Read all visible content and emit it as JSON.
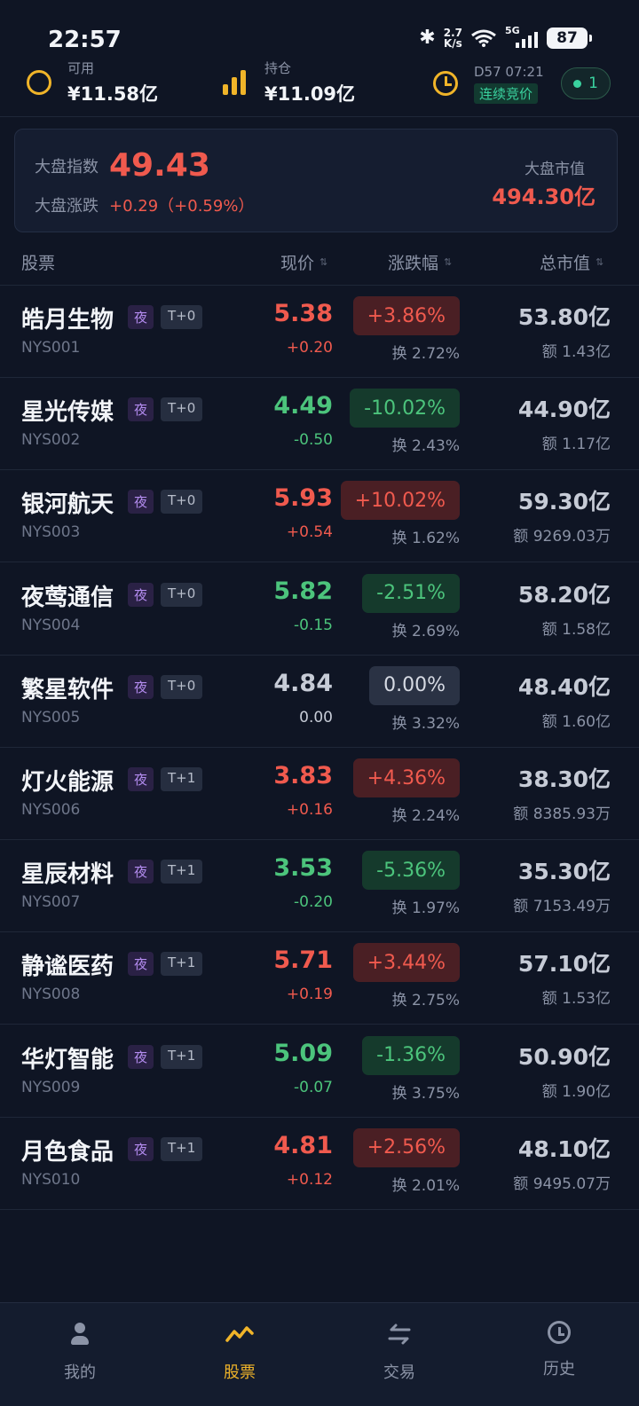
{
  "status_bar": {
    "time": "22:57",
    "net_speed_value": "2.7",
    "net_speed_unit": "K/s",
    "network": "5G",
    "battery": "87"
  },
  "header": {
    "available_label": "可用",
    "available_value": "¥11.58亿",
    "holding_label": "持仓",
    "holding_value": "¥11.09亿",
    "day_time": "D57 07:21",
    "phase": "连续竞价",
    "online_count": "1"
  },
  "index_card": {
    "index_label": "大盘指数",
    "index_value": "49.43",
    "change_label": "大盘涨跌",
    "change_value": "+0.29（+0.59%）",
    "market_cap_label": "大盘市值",
    "market_cap_value": "494.30亿"
  },
  "columns": {
    "stock": "股票",
    "price": "现价",
    "change_pct": "涨跌幅",
    "market_cap": "总市值"
  },
  "stocks": [
    {
      "name": "皓月生物",
      "tag_night": "夜",
      "tag_t": "T+0",
      "code": "NYS001",
      "price": "5.38",
      "delta": "+0.20",
      "pct": "+3.86%",
      "turnover": "换 2.72%",
      "market_cap": "53.80亿",
      "amount": "额 1.43亿",
      "trend": "up"
    },
    {
      "name": "星光传媒",
      "tag_night": "夜",
      "tag_t": "T+0",
      "code": "NYS002",
      "price": "4.49",
      "delta": "-0.50",
      "pct": "-10.02%",
      "turnover": "换 2.43%",
      "market_cap": "44.90亿",
      "amount": "额 1.17亿",
      "trend": "down"
    },
    {
      "name": "银河航天",
      "tag_night": "夜",
      "tag_t": "T+0",
      "code": "NYS003",
      "price": "5.93",
      "delta": "+0.54",
      "pct": "+10.02%",
      "turnover": "换 1.62%",
      "market_cap": "59.30亿",
      "amount": "额 9269.03万",
      "trend": "up"
    },
    {
      "name": "夜莺通信",
      "tag_night": "夜",
      "tag_t": "T+0",
      "code": "NYS004",
      "price": "5.82",
      "delta": "-0.15",
      "pct": "-2.51%",
      "turnover": "换 2.69%",
      "market_cap": "58.20亿",
      "amount": "额 1.58亿",
      "trend": "down"
    },
    {
      "name": "繁星软件",
      "tag_night": "夜",
      "tag_t": "T+0",
      "code": "NYS005",
      "price": "4.84",
      "delta": "0.00",
      "pct": "0.00%",
      "turnover": "换 3.32%",
      "market_cap": "48.40亿",
      "amount": "额 1.60亿",
      "trend": "flat"
    },
    {
      "name": "灯火能源",
      "tag_night": "夜",
      "tag_t": "T+1",
      "code": "NYS006",
      "price": "3.83",
      "delta": "+0.16",
      "pct": "+4.36%",
      "turnover": "换 2.24%",
      "market_cap": "38.30亿",
      "amount": "额 8385.93万",
      "trend": "up"
    },
    {
      "name": "星辰材料",
      "tag_night": "夜",
      "tag_t": "T+1",
      "code": "NYS007",
      "price": "3.53",
      "delta": "-0.20",
      "pct": "-5.36%",
      "turnover": "换 1.97%",
      "market_cap": "35.30亿",
      "amount": "额 7153.49万",
      "trend": "down"
    },
    {
      "name": "静谧医药",
      "tag_night": "夜",
      "tag_t": "T+1",
      "code": "NYS008",
      "price": "5.71",
      "delta": "+0.19",
      "pct": "+3.44%",
      "turnover": "换 2.75%",
      "market_cap": "57.10亿",
      "amount": "额 1.53亿",
      "trend": "up"
    },
    {
      "name": "华灯智能",
      "tag_night": "夜",
      "tag_t": "T+1",
      "code": "NYS009",
      "price": "5.09",
      "delta": "-0.07",
      "pct": "-1.36%",
      "turnover": "换 3.75%",
      "market_cap": "50.90亿",
      "amount": "额 1.90亿",
      "trend": "down"
    },
    {
      "name": "月色食品",
      "tag_night": "夜",
      "tag_t": "T+1",
      "code": "NYS010",
      "price": "4.81",
      "delta": "+0.12",
      "pct": "+2.56%",
      "turnover": "换 2.01%",
      "market_cap": "48.10亿",
      "amount": "额 9495.07万",
      "trend": "up"
    }
  ],
  "nav": [
    {
      "label": "我的",
      "icon": "person-icon",
      "active": false
    },
    {
      "label": "股票",
      "icon": "trend-icon",
      "active": true
    },
    {
      "label": "交易",
      "icon": "swap-icon",
      "active": false
    },
    {
      "label": "历史",
      "icon": "history-icon",
      "active": false
    }
  ],
  "colors": {
    "up": "#f05a4e",
    "down": "#4cc47c",
    "accent": "#f0b429",
    "background": "#0f1524"
  }
}
